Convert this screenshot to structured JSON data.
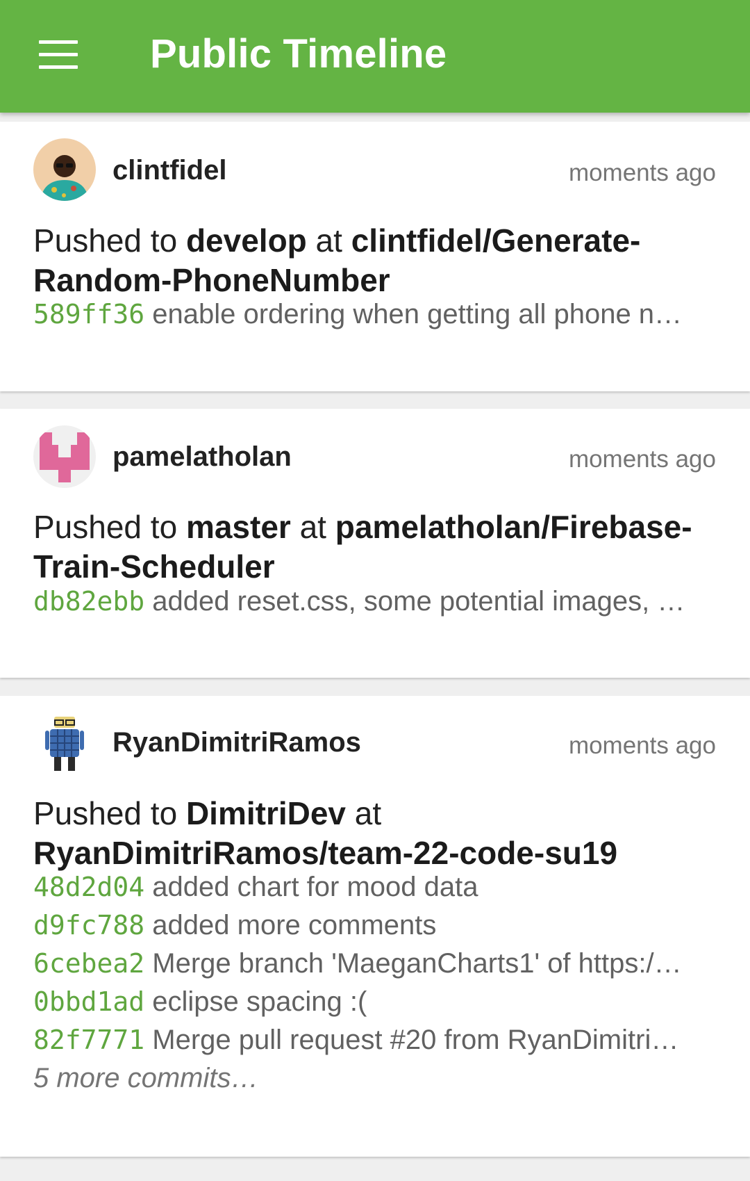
{
  "appbar": {
    "title": "Public Timeline"
  },
  "events": [
    {
      "username": "clintfidel",
      "time": "moments ago",
      "prefix": "Pushed to ",
      "branch": "develop",
      "at": " at ",
      "repo": "clintfidel/Generate-Random-PhoneNumber",
      "commits": [
        {
          "sha": "589ff36",
          "message": "enable ordering when getting all phone n…"
        }
      ]
    },
    {
      "username": "pamelatholan",
      "time": "moments ago",
      "prefix": "Pushed to ",
      "branch": "master",
      "at": " at ",
      "repo": "pamelatholan/Firebase-Train-Scheduler",
      "commits": [
        {
          "sha": "db82ebb",
          "message": "added reset.css, some potential images, …"
        }
      ]
    },
    {
      "username": "RyanDimitriRamos",
      "time": "moments ago",
      "prefix": "Pushed to ",
      "branch": "DimitriDev",
      "at": " at ",
      "repo": "RyanDimitriRamos/team-22-code-su19",
      "commits": [
        {
          "sha": "48d2d04",
          "message": "added chart for mood data"
        },
        {
          "sha": "d9fc788",
          "message": "added more comments"
        },
        {
          "sha": "6cebea2",
          "message": "Merge branch 'MaeganCharts1' of https:/…"
        },
        {
          "sha": "0bbd1ad",
          "message": "eclipse spacing :("
        },
        {
          "sha": "82f7771",
          "message": "Merge pull request #20 from RyanDimitri…"
        }
      ],
      "more": "5 more commits…"
    }
  ]
}
